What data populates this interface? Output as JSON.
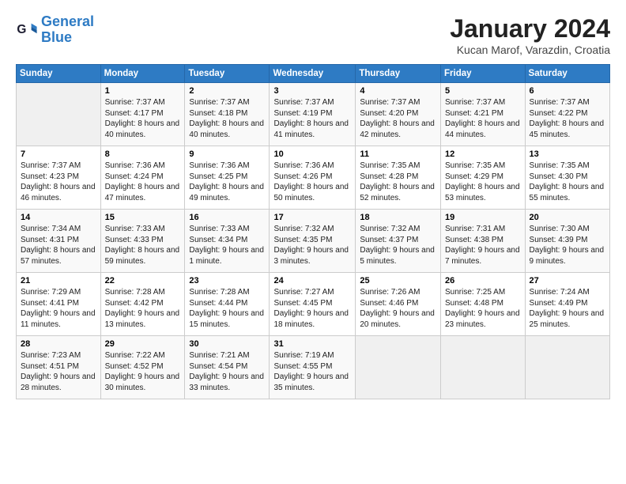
{
  "header": {
    "logo_line1": "General",
    "logo_line2": "Blue",
    "month": "January 2024",
    "location": "Kucan Marof, Varazdin, Croatia"
  },
  "days_of_week": [
    "Sunday",
    "Monday",
    "Tuesday",
    "Wednesday",
    "Thursday",
    "Friday",
    "Saturday"
  ],
  "weeks": [
    [
      {
        "day": "",
        "sunrise": "",
        "sunset": "",
        "daylight": ""
      },
      {
        "day": "1",
        "sunrise": "Sunrise: 7:37 AM",
        "sunset": "Sunset: 4:17 PM",
        "daylight": "Daylight: 8 hours and 40 minutes."
      },
      {
        "day": "2",
        "sunrise": "Sunrise: 7:37 AM",
        "sunset": "Sunset: 4:18 PM",
        "daylight": "Daylight: 8 hours and 40 minutes."
      },
      {
        "day": "3",
        "sunrise": "Sunrise: 7:37 AM",
        "sunset": "Sunset: 4:19 PM",
        "daylight": "Daylight: 8 hours and 41 minutes."
      },
      {
        "day": "4",
        "sunrise": "Sunrise: 7:37 AM",
        "sunset": "Sunset: 4:20 PM",
        "daylight": "Daylight: 8 hours and 42 minutes."
      },
      {
        "day": "5",
        "sunrise": "Sunrise: 7:37 AM",
        "sunset": "Sunset: 4:21 PM",
        "daylight": "Daylight: 8 hours and 44 minutes."
      },
      {
        "day": "6",
        "sunrise": "Sunrise: 7:37 AM",
        "sunset": "Sunset: 4:22 PM",
        "daylight": "Daylight: 8 hours and 45 minutes."
      }
    ],
    [
      {
        "day": "7",
        "sunrise": "Sunrise: 7:37 AM",
        "sunset": "Sunset: 4:23 PM",
        "daylight": "Daylight: 8 hours and 46 minutes."
      },
      {
        "day": "8",
        "sunrise": "Sunrise: 7:36 AM",
        "sunset": "Sunset: 4:24 PM",
        "daylight": "Daylight: 8 hours and 47 minutes."
      },
      {
        "day": "9",
        "sunrise": "Sunrise: 7:36 AM",
        "sunset": "Sunset: 4:25 PM",
        "daylight": "Daylight: 8 hours and 49 minutes."
      },
      {
        "day": "10",
        "sunrise": "Sunrise: 7:36 AM",
        "sunset": "Sunset: 4:26 PM",
        "daylight": "Daylight: 8 hours and 50 minutes."
      },
      {
        "day": "11",
        "sunrise": "Sunrise: 7:35 AM",
        "sunset": "Sunset: 4:28 PM",
        "daylight": "Daylight: 8 hours and 52 minutes."
      },
      {
        "day": "12",
        "sunrise": "Sunrise: 7:35 AM",
        "sunset": "Sunset: 4:29 PM",
        "daylight": "Daylight: 8 hours and 53 minutes."
      },
      {
        "day": "13",
        "sunrise": "Sunrise: 7:35 AM",
        "sunset": "Sunset: 4:30 PM",
        "daylight": "Daylight: 8 hours and 55 minutes."
      }
    ],
    [
      {
        "day": "14",
        "sunrise": "Sunrise: 7:34 AM",
        "sunset": "Sunset: 4:31 PM",
        "daylight": "Daylight: 8 hours and 57 minutes."
      },
      {
        "day": "15",
        "sunrise": "Sunrise: 7:33 AM",
        "sunset": "Sunset: 4:33 PM",
        "daylight": "Daylight: 8 hours and 59 minutes."
      },
      {
        "day": "16",
        "sunrise": "Sunrise: 7:33 AM",
        "sunset": "Sunset: 4:34 PM",
        "daylight": "Daylight: 9 hours and 1 minute."
      },
      {
        "day": "17",
        "sunrise": "Sunrise: 7:32 AM",
        "sunset": "Sunset: 4:35 PM",
        "daylight": "Daylight: 9 hours and 3 minutes."
      },
      {
        "day": "18",
        "sunrise": "Sunrise: 7:32 AM",
        "sunset": "Sunset: 4:37 PM",
        "daylight": "Daylight: 9 hours and 5 minutes."
      },
      {
        "day": "19",
        "sunrise": "Sunrise: 7:31 AM",
        "sunset": "Sunset: 4:38 PM",
        "daylight": "Daylight: 9 hours and 7 minutes."
      },
      {
        "day": "20",
        "sunrise": "Sunrise: 7:30 AM",
        "sunset": "Sunset: 4:39 PM",
        "daylight": "Daylight: 9 hours and 9 minutes."
      }
    ],
    [
      {
        "day": "21",
        "sunrise": "Sunrise: 7:29 AM",
        "sunset": "Sunset: 4:41 PM",
        "daylight": "Daylight: 9 hours and 11 minutes."
      },
      {
        "day": "22",
        "sunrise": "Sunrise: 7:28 AM",
        "sunset": "Sunset: 4:42 PM",
        "daylight": "Daylight: 9 hours and 13 minutes."
      },
      {
        "day": "23",
        "sunrise": "Sunrise: 7:28 AM",
        "sunset": "Sunset: 4:44 PM",
        "daylight": "Daylight: 9 hours and 15 minutes."
      },
      {
        "day": "24",
        "sunrise": "Sunrise: 7:27 AM",
        "sunset": "Sunset: 4:45 PM",
        "daylight": "Daylight: 9 hours and 18 minutes."
      },
      {
        "day": "25",
        "sunrise": "Sunrise: 7:26 AM",
        "sunset": "Sunset: 4:46 PM",
        "daylight": "Daylight: 9 hours and 20 minutes."
      },
      {
        "day": "26",
        "sunrise": "Sunrise: 7:25 AM",
        "sunset": "Sunset: 4:48 PM",
        "daylight": "Daylight: 9 hours and 23 minutes."
      },
      {
        "day": "27",
        "sunrise": "Sunrise: 7:24 AM",
        "sunset": "Sunset: 4:49 PM",
        "daylight": "Daylight: 9 hours and 25 minutes."
      }
    ],
    [
      {
        "day": "28",
        "sunrise": "Sunrise: 7:23 AM",
        "sunset": "Sunset: 4:51 PM",
        "daylight": "Daylight: 9 hours and 28 minutes."
      },
      {
        "day": "29",
        "sunrise": "Sunrise: 7:22 AM",
        "sunset": "Sunset: 4:52 PM",
        "daylight": "Daylight: 9 hours and 30 minutes."
      },
      {
        "day": "30",
        "sunrise": "Sunrise: 7:21 AM",
        "sunset": "Sunset: 4:54 PM",
        "daylight": "Daylight: 9 hours and 33 minutes."
      },
      {
        "day": "31",
        "sunrise": "Sunrise: 7:19 AM",
        "sunset": "Sunset: 4:55 PM",
        "daylight": "Daylight: 9 hours and 35 minutes."
      },
      {
        "day": "",
        "sunrise": "",
        "sunset": "",
        "daylight": ""
      },
      {
        "day": "",
        "sunrise": "",
        "sunset": "",
        "daylight": ""
      },
      {
        "day": "",
        "sunrise": "",
        "sunset": "",
        "daylight": ""
      }
    ]
  ]
}
